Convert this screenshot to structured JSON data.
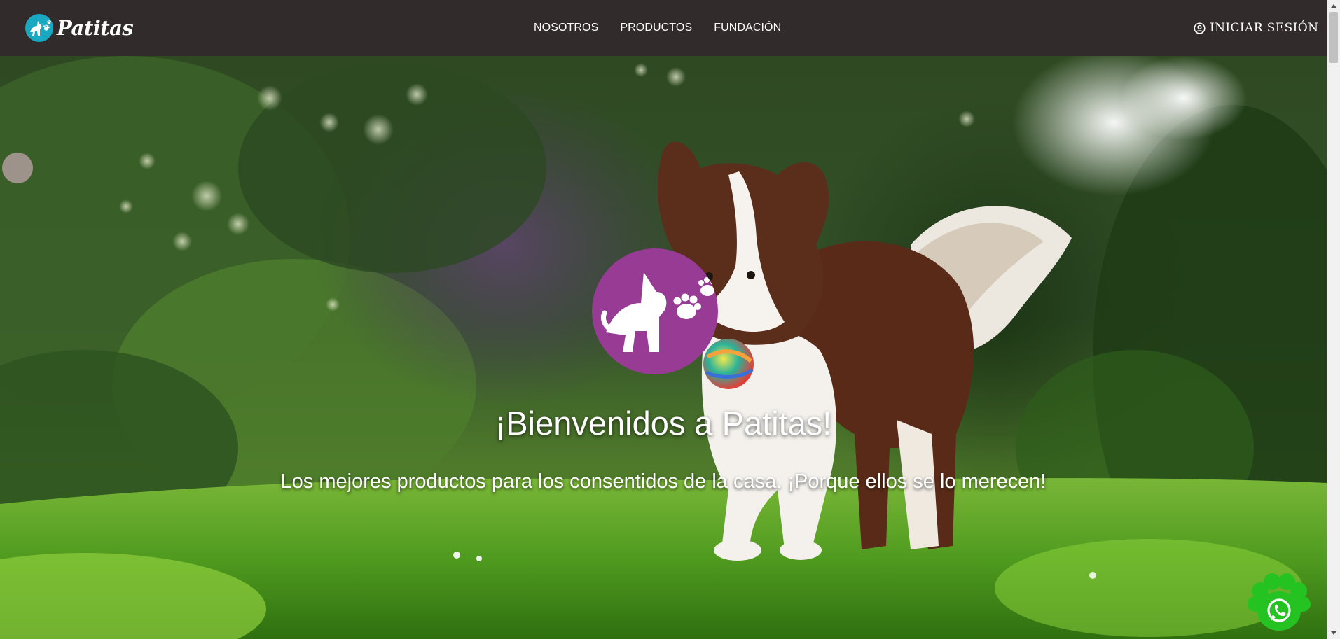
{
  "header": {
    "brand": "Patitas",
    "nav": [
      {
        "label": "NOSOTROS"
      },
      {
        "label": "PRODUCTOS"
      },
      {
        "label": "FUNDACIÓN"
      }
    ],
    "login_label": "INICIAR SESIÓN"
  },
  "hero": {
    "title": "¡Bienvenidos a Patitas!",
    "subtitle": "Los mejores productos para los consentidos de la casa. ¡Porque ellos se lo merecen!"
  },
  "icons": {
    "logo": "dog-paw-logo-icon",
    "login": "user-circle-icon",
    "floating": "whatsapp-paw-icon"
  },
  "colors": {
    "header_bg": "#322b2c",
    "logo_teal": "#19a8c2",
    "hero_logo_purple": "#973b94",
    "whatsapp_green": "#25c322"
  }
}
